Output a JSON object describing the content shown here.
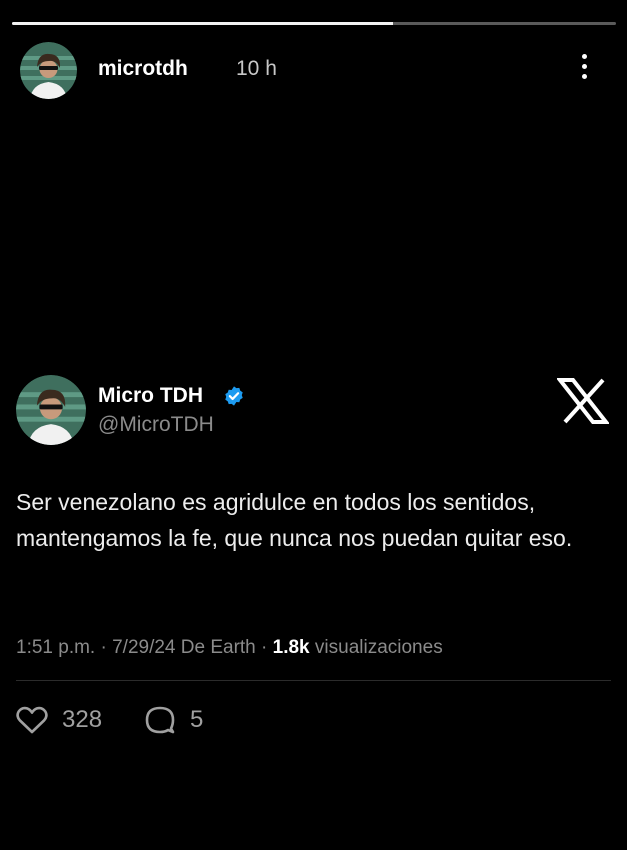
{
  "story": {
    "progress_fraction": 0.63,
    "username": "microtdh",
    "time_ago": "10 h",
    "avatar_icon": "user-avatar-icon",
    "menu_icon": "more-vertical-icon"
  },
  "tweet": {
    "display_name": "Micro TDH",
    "handle": "@MicroTDH",
    "verified_icon": "verified-badge-icon",
    "verified_color": "#1d9bf0",
    "platform_icon": "x-logo-icon",
    "text": "Ser venezolano es agridulce en todos los sentidos, mantengamos la fe, que nunca nos puedan quitar eso.",
    "meta_prefix": "1:51 p.m. · 7/29/24 De Earth · ",
    "views": "1.8k",
    "views_label": " visualizaciones",
    "likes": "328",
    "replies": "5",
    "like_icon": "heart-icon",
    "reply_icon": "comment-icon"
  }
}
